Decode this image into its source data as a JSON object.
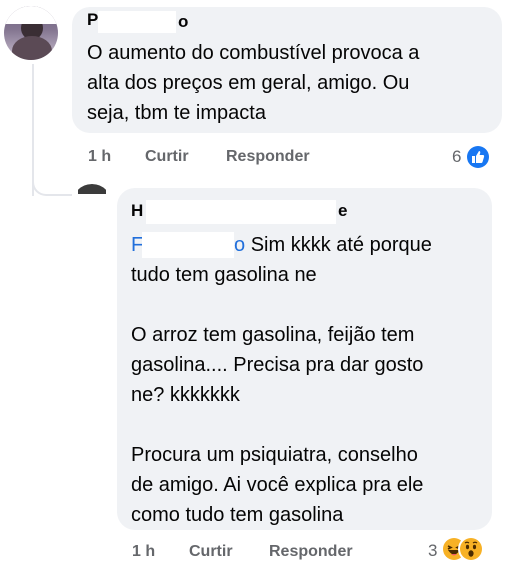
{
  "comment": {
    "author_first": "P",
    "author_last": "o",
    "text_lines": [
      "O aumento do combustível provoca a",
      "alta dos preços em geral, amigo. Ou",
      "seja, tbm te impacta"
    ],
    "time": "1 h",
    "like_label": "Curtir",
    "reply_label": "Responder",
    "reaction_count": "6",
    "reaction_icon": "like-icon"
  },
  "reply": {
    "author_first": "H",
    "author_last": "e",
    "mention_first": "F",
    "mention_last": "o",
    "first_line_rest": "Sim kkkk até porque",
    "text_lines": [
      "tudo tem gasolina ne",
      "",
      "O arroz tem gasolina, feijão tem",
      "gasolina.... Precisa pra dar gosto",
      "ne? kkkkkkk",
      "",
      "Procura um psiquiatra, conselho",
      "de amigo. Ai você explica pra ele",
      "como tudo tem gasolina"
    ],
    "time": "1 h",
    "like_label": "Curtir",
    "reply_label": "Responder",
    "reaction_count": "3",
    "reaction_icons": [
      "haha-icon",
      "wow-icon"
    ]
  },
  "colors": {
    "bubble": "#f0f2f5",
    "meta_text": "#65676b",
    "mention": "#216fdb",
    "like_blue": "#1877f2",
    "emoji_yellow": "#f7b125"
  }
}
